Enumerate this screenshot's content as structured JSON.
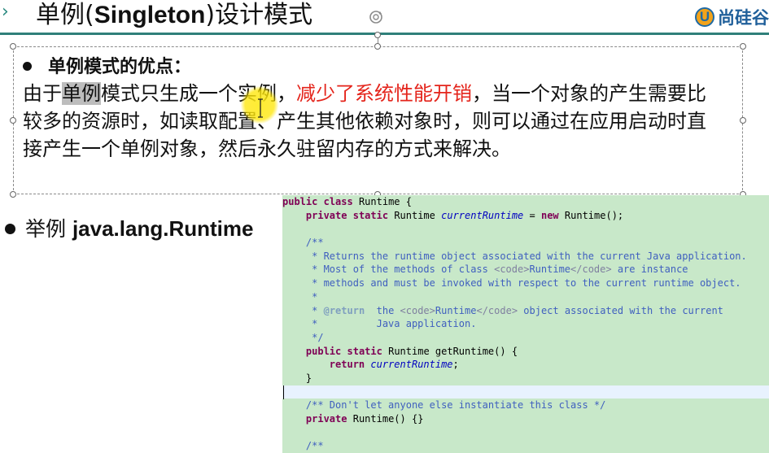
{
  "slide": {
    "title_cn_prefix": "单例(",
    "title_en": "Singleton",
    "title_cn_suffix": ")设计模式",
    "logo_text": "尚硅谷",
    "logo_mark": "U"
  },
  "advantages": {
    "heading": "单例模式的优点：",
    "text_1": "由于",
    "text_highlight": "单例",
    "text_2": "模式只生成一个实例，",
    "text_red": "减少了系统性能开销",
    "text_3": "，当一个对象的产生需要比较多的资源时，如读取配置、产生其他依赖对象时，则可以通过在应用启动时直接产生一个单例对象，然后永久驻留内存的方式来解决。"
  },
  "example": {
    "label": "举例 ",
    "class_name": "java.lang.Runtime"
  },
  "code": {
    "kw_public": "public",
    "kw_class": "class",
    "kw_private": "private",
    "kw_static": "static",
    "kw_new": "new",
    "kw_return": "return",
    "type_runtime": "Runtime",
    "field": "currentRuntime",
    "method": "getRuntime",
    "l1_tail": " {",
    "l2_tail": " = ",
    "l2_end": "();",
    "doc_open": "/**",
    "l5": " * Returns the runtime object associated with the current Java application.",
    "l6_a": " * Most of the methods of class ",
    "tag_code_open": "<code>",
    "tag_code_close": "</code>",
    "l6_b": " are instance",
    "l7": " * methods and must be invoked with respect to the current runtime object.",
    "l8": " *",
    "l9_star": " * ",
    "at_return": "@return",
    "l9_a": "  the ",
    "l9_b": " object associated with the current",
    "l10": " *          Java application.",
    "doc_close": " */",
    "l11_tail": "() {",
    "l12_end": ";",
    "close_brace": "}",
    "l15": "/** Don't let anyone else instantiate this class */",
    "l16_tail": "() {}"
  }
}
